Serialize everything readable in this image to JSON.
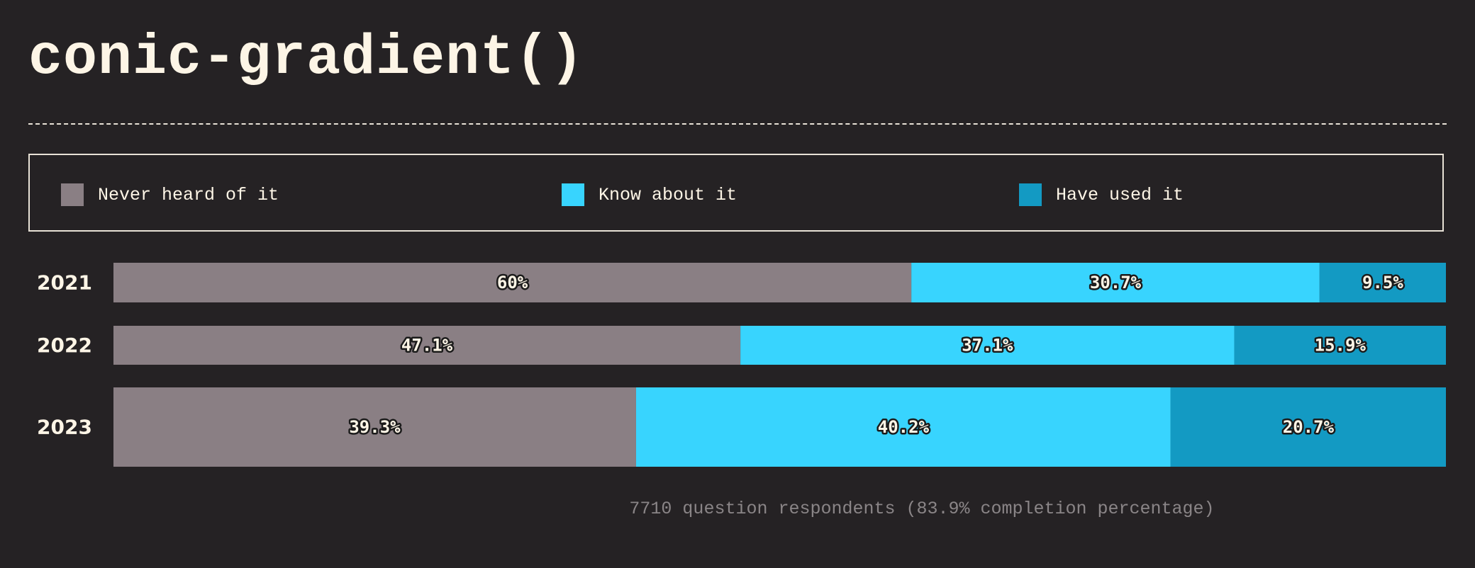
{
  "title": "conic-gradient()",
  "legend": [
    {
      "label": "Never heard of it",
      "color": "#8a7f84"
    },
    {
      "label": "Know about it",
      "color": "#38d4fe"
    },
    {
      "label": "Have used it",
      "color": "#139ac3"
    }
  ],
  "footnote": "7710 question respondents (83.9% completion percentage)",
  "chart_data": {
    "type": "bar",
    "orientation": "horizontal",
    "stacked": true,
    "normalized": true,
    "categories": [
      "2021",
      "2022",
      "2023"
    ],
    "series": [
      {
        "name": "Never heard of it",
        "color": "#8a7f84",
        "values": [
          60,
          47.1,
          39.3
        ],
        "labels": [
          "60%",
          "47.1%",
          "39.3%"
        ]
      },
      {
        "name": "Know about it",
        "color": "#38d4fe",
        "values": [
          30.7,
          37.1,
          40.2
        ],
        "labels": [
          "30.7%",
          "37.1%",
          "40.2%"
        ]
      },
      {
        "name": "Have used it",
        "color": "#139ac3",
        "values": [
          9.5,
          15.9,
          20.7
        ],
        "labels": [
          "9.5%",
          "15.9%",
          "20.7%"
        ]
      }
    ],
    "xlim": [
      0,
      100
    ],
    "legend": "top"
  }
}
